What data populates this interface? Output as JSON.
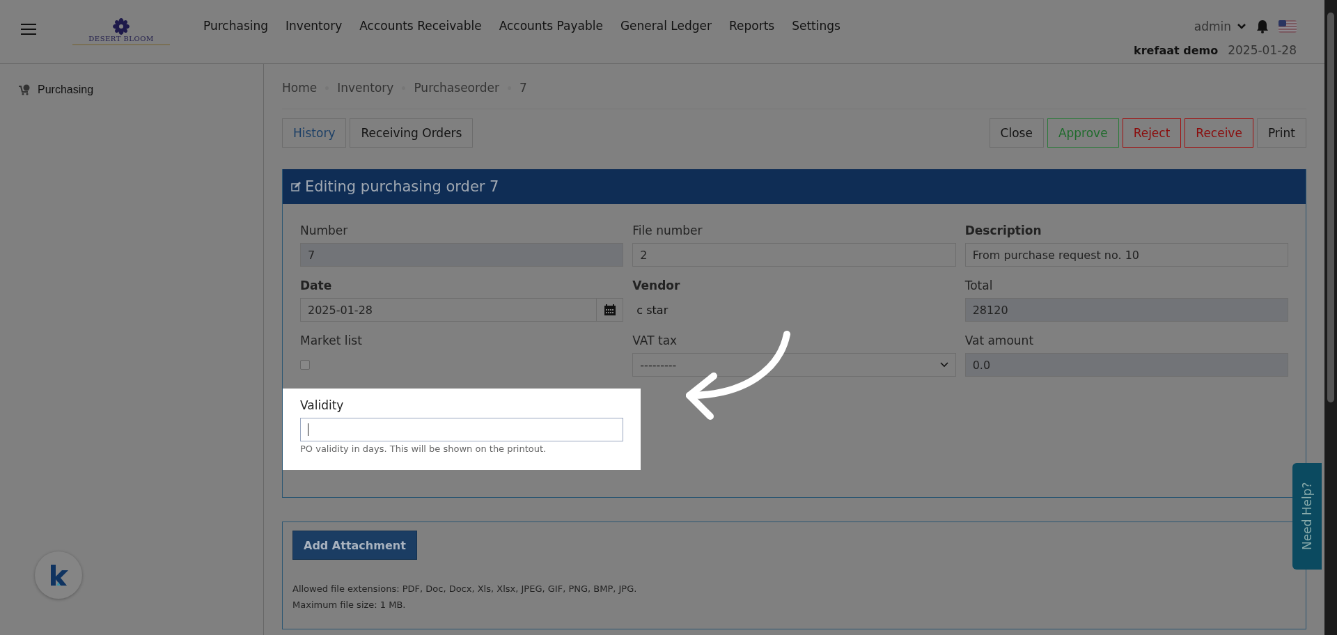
{
  "header": {
    "nav": [
      "Purchasing",
      "Inventory",
      "Accounts Receivable",
      "Accounts Payable",
      "General Ledger",
      "Reports",
      "Settings"
    ],
    "logo_text": "DESERT BLOOM",
    "user": "admin",
    "company": "krefaat demo",
    "date": "2025-01-28"
  },
  "sidebar": {
    "items": [
      {
        "label": "Purchasing",
        "selected": true
      }
    ]
  },
  "breadcrumb": [
    "Home",
    "Inventory",
    "Purchaseorder",
    "7"
  ],
  "tabs": [
    {
      "label": "History",
      "selected": true
    },
    {
      "label": "Receiving Orders",
      "selected": false
    }
  ],
  "actions": [
    {
      "label": "Close",
      "kind": "plain"
    },
    {
      "label": "Approve",
      "kind": "approve"
    },
    {
      "label": "Reject",
      "kind": "danger"
    },
    {
      "label": "Receive",
      "kind": "danger"
    },
    {
      "label": "Print",
      "kind": "plain"
    }
  ],
  "form": {
    "title": "Editing purchasing order 7",
    "fields": [
      {
        "label": "Number",
        "kind": "input",
        "value": "7",
        "readonly": true,
        "required": false,
        "highlighted": false
      },
      {
        "label": "File number",
        "kind": "input",
        "value": "2",
        "readonly": false,
        "required": false,
        "highlighted": false
      },
      {
        "label": "Description",
        "kind": "input",
        "value": "From purchase request no. 10",
        "readonly": false,
        "required": true,
        "highlighted": false
      },
      {
        "label": "Date",
        "kind": "date",
        "value": "2025-01-28",
        "readonly": false,
        "required": true,
        "highlighted": false
      },
      {
        "label": "Vendor",
        "kind": "text",
        "value": "c star",
        "readonly": false,
        "required": true,
        "highlighted": false
      },
      {
        "label": "Total",
        "kind": "input",
        "value": "28120",
        "readonly": true,
        "required": false,
        "highlighted": false
      },
      {
        "label": "Market list",
        "kind": "checkbox",
        "checked": false,
        "readonly": false,
        "required": false,
        "highlighted": false
      },
      {
        "label": "VAT tax",
        "kind": "select",
        "value": "---------",
        "readonly": false,
        "required": false,
        "highlighted": false
      },
      {
        "label": "Vat amount",
        "kind": "input",
        "value": "0.0",
        "readonly": true,
        "required": false,
        "highlighted": false
      },
      {
        "label": "Validity",
        "kind": "input",
        "help": "PO validity in days. This will be shown on the printout.",
        "readonly": false,
        "required": false,
        "highlighted": true
      }
    ]
  },
  "attachments": {
    "button": "Add Attachment",
    "notes": [
      "Allowed file extensions: PDF, Doc, Docx, Xls, Xlsx, JPEG, GIF, PNG, BMP, JPG.",
      "Maximum file size: 1 MB."
    ]
  },
  "help_tab": "Need Help?"
}
